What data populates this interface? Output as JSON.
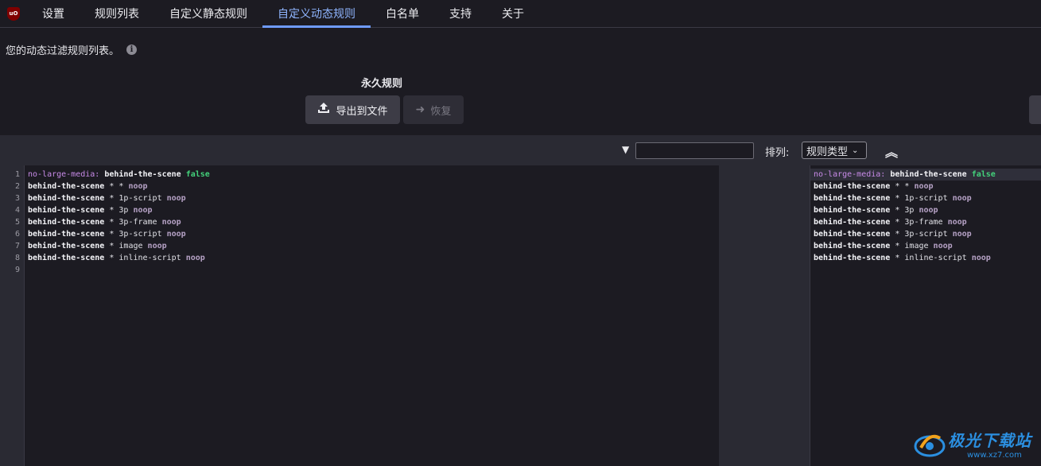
{
  "app": {
    "logo_text": "uO"
  },
  "tabs": [
    {
      "label": "设置"
    },
    {
      "label": "规则列表"
    },
    {
      "label": "自定义静态规则"
    },
    {
      "label": "自定义动态规则",
      "active": true
    },
    {
      "label": "白名单"
    },
    {
      "label": "支持"
    },
    {
      "label": "关于"
    }
  ],
  "header": {
    "description": "您的动态过滤规则列表。",
    "info_icon": "info-icon",
    "permanent_title": "永久规则",
    "export_label": "导出到文件",
    "revert_label": "恢复"
  },
  "toolbar": {
    "filter_value": "",
    "sort_label": "排列:",
    "sort_selected": "规则类型"
  },
  "editor": {
    "line_numbers": [
      "1",
      "2",
      "3",
      "4",
      "5",
      "6",
      "7",
      "8",
      "9"
    ],
    "left_rules": [
      [
        "no-large-media:",
        "behind-the-scene",
        "false"
      ],
      [
        "behind-the-scene",
        "* *",
        "noop"
      ],
      [
        "behind-the-scene",
        "* 1p-script",
        "noop"
      ],
      [
        "behind-the-scene",
        "* 3p",
        "noop"
      ],
      [
        "behind-the-scene",
        "* 3p-frame",
        "noop"
      ],
      [
        "behind-the-scene",
        "* 3p-script",
        "noop"
      ],
      [
        "behind-the-scene",
        "* image",
        "noop"
      ],
      [
        "behind-the-scene",
        "* inline-script",
        "noop"
      ]
    ],
    "right_rules": [
      [
        "no-large-media:",
        "behind-the-scene",
        "false"
      ],
      [
        "behind-the-scene",
        "* *",
        "noop"
      ],
      [
        "behind-the-scene",
        "* 1p-script",
        "noop"
      ],
      [
        "behind-the-scene",
        "* 3p",
        "noop"
      ],
      [
        "behind-the-scene",
        "* 3p-frame",
        "noop"
      ],
      [
        "behind-the-scene",
        "* 3p-script",
        "noop"
      ],
      [
        "behind-the-scene",
        "* image",
        "noop"
      ],
      [
        "behind-the-scene",
        "* inline-script",
        "noop"
      ]
    ]
  },
  "watermark": {
    "title": "极光下载站",
    "url": "www.xz7.com"
  },
  "colors": {
    "accent": "#6f9bff",
    "background": "#1c1b22",
    "panel": "#2a2a33"
  }
}
